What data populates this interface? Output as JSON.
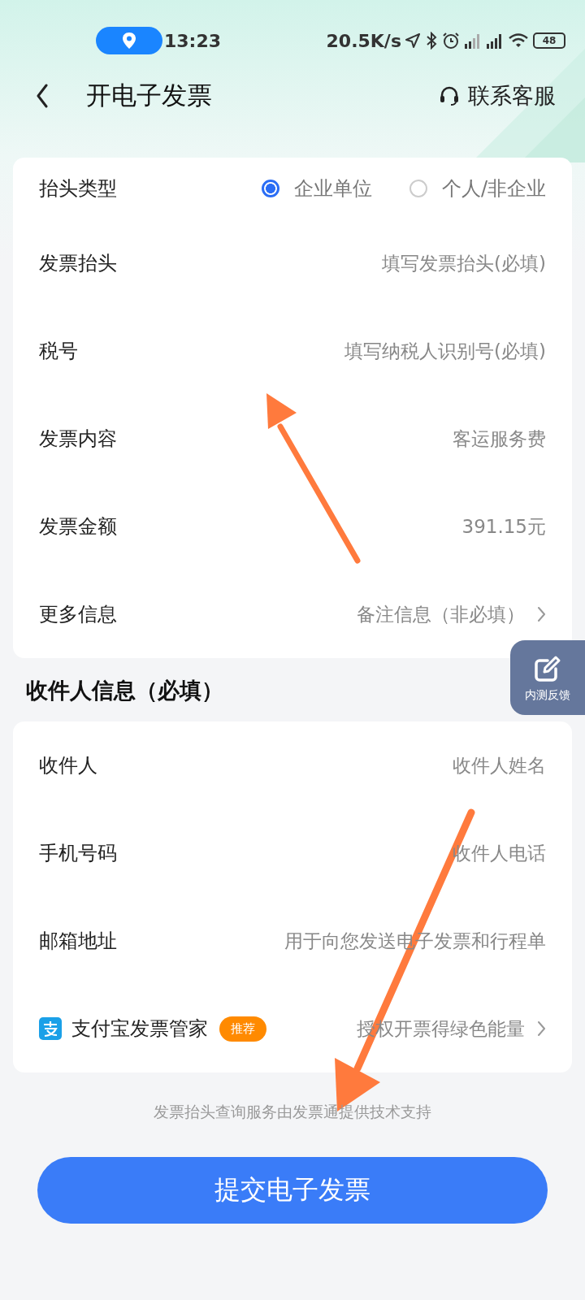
{
  "status_bar": {
    "time": "13:23",
    "net_speed": "20.5K/s",
    "battery": "48"
  },
  "header": {
    "title": "开电子发票",
    "service": "联系客服"
  },
  "invoice_rows": [
    {
      "kind": "radio",
      "label": "抬头类型",
      "options": [
        {
          "label": "企业单位",
          "selected": true
        },
        {
          "label": "个人/非企业",
          "selected": false
        }
      ]
    },
    {
      "kind": "field",
      "label": "发票抬头",
      "placeholder": "填写发票抬头(必填)"
    },
    {
      "kind": "field",
      "label": "税号",
      "placeholder": "填写纳税人识别号(必填)"
    },
    {
      "kind": "value",
      "label": "发票内容",
      "value": "客运服务费"
    },
    {
      "kind": "value",
      "label": "发票金额",
      "value": "391.15元"
    },
    {
      "kind": "link",
      "label": "更多信息",
      "value": "备注信息（非必填）"
    }
  ],
  "recipient_title": "收件人信息（必填）",
  "recipient_rows": [
    {
      "kind": "field",
      "label": "收件人",
      "placeholder": "收件人姓名"
    },
    {
      "kind": "field",
      "label": "手机号码",
      "placeholder": "收件人电话"
    },
    {
      "kind": "field",
      "label": "邮箱地址",
      "placeholder": "用于向您发送电子发票和行程单"
    },
    {
      "kind": "promo",
      "label": "支付宝发票管家",
      "badge": "推荐",
      "value": "授权开票得绿色能量"
    }
  ],
  "footer_note": "发票抬头查询服务由发票通提供技术支持",
  "submit_button": "提交电子发票",
  "feedback": "内测反馈"
}
